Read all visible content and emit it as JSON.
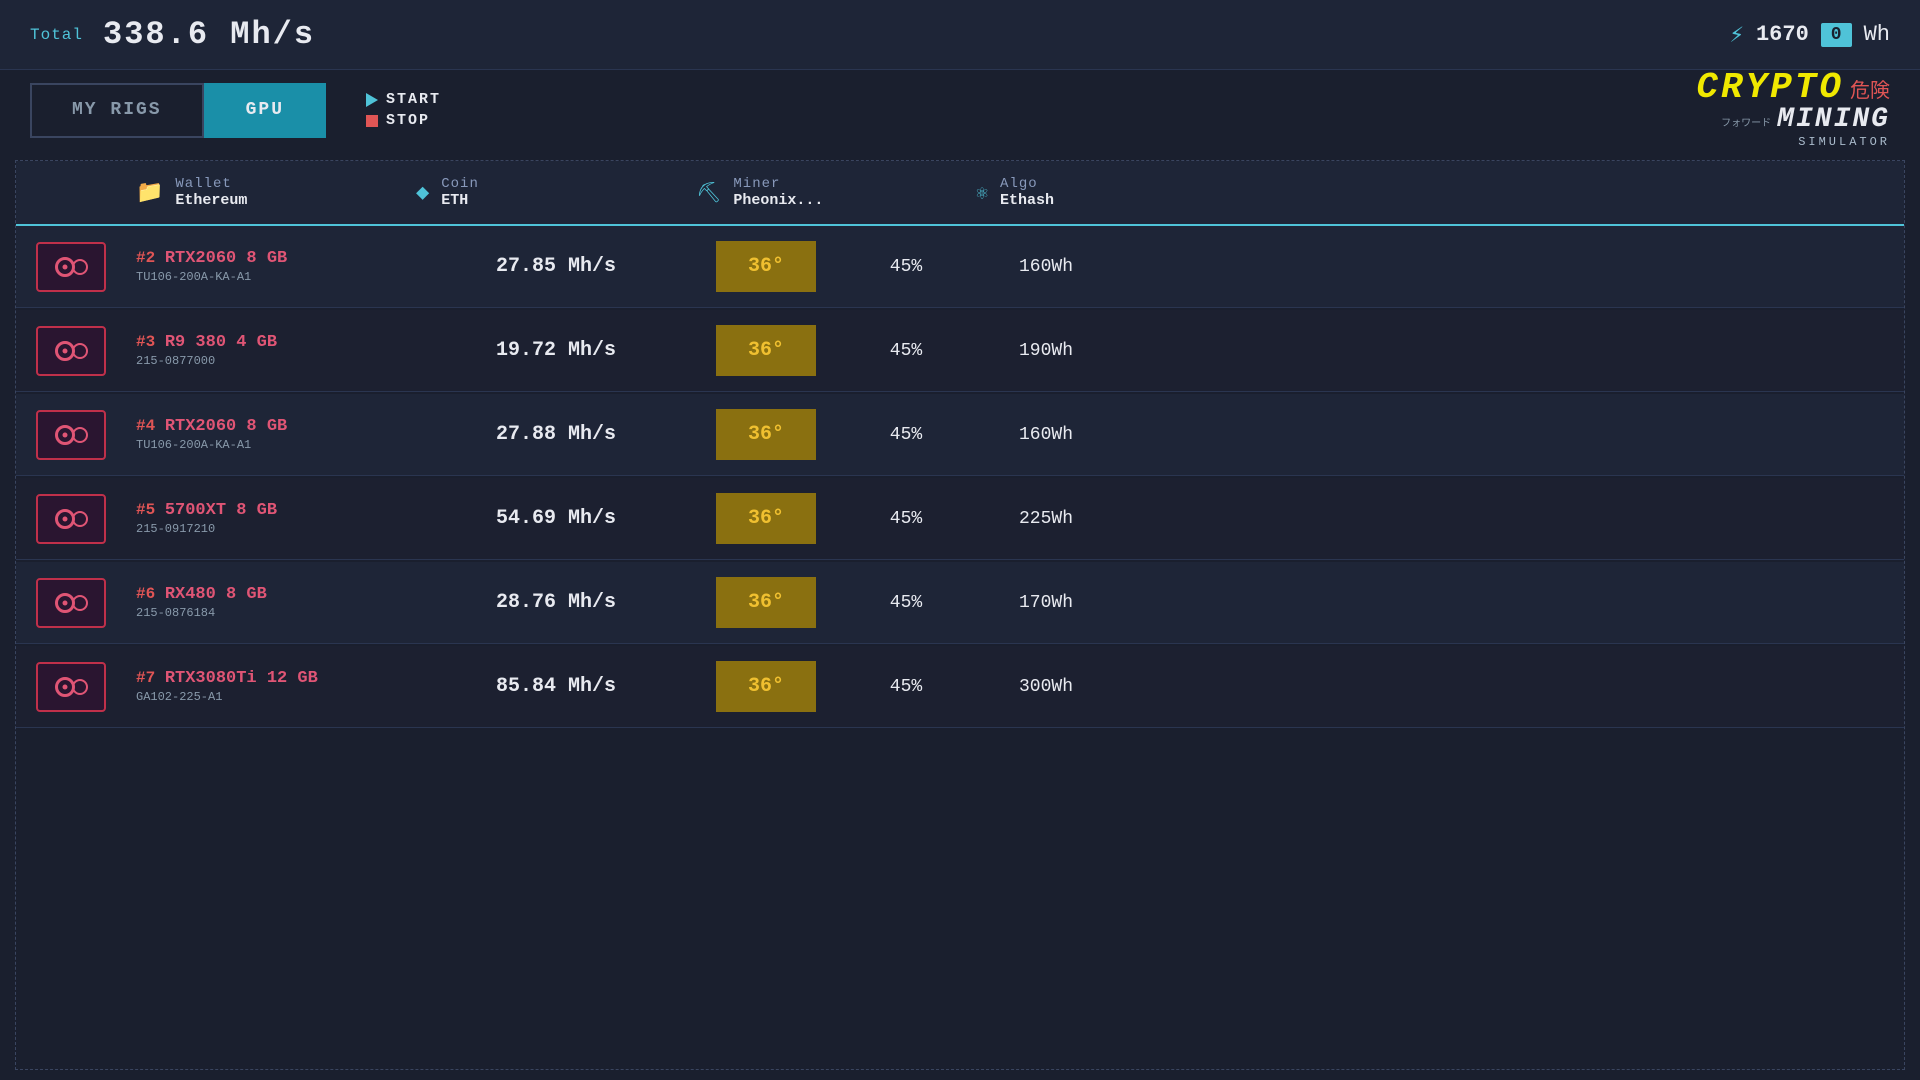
{
  "topbar": {
    "total_label": "Total",
    "hashrate": "338.6 Mh/s",
    "power_icon": "⚡",
    "power_value": "1670",
    "power_zero": "0",
    "power_unit": "Wh"
  },
  "nav": {
    "tab_rigs": "MY RIGS",
    "tab_gpu": "GPU",
    "btn_start": "START",
    "btn_stop": "STOP"
  },
  "logo": {
    "line1": "CRYPTO",
    "line1_jp": "危険",
    "line2": "MINING",
    "line3": "SIMULATOR",
    "line3_jp": "フォワード"
  },
  "table_header": {
    "wallet_label": "Wallet",
    "wallet_value": "Ethereum",
    "coin_label": "Coin",
    "coin_value": "ETH",
    "miner_label": "Miner",
    "miner_value": "Pheonix...",
    "algo_label": "Algo",
    "algo_value": "Ethash"
  },
  "gpus": [
    {
      "number": "#2",
      "name": "RTX2060 8 GB",
      "id": "TU106-200A-KA-A1",
      "hashrate": "27.85 Mh/s",
      "temp": "36°",
      "fan": "45%",
      "power": "160Wh"
    },
    {
      "number": "#3",
      "name": "R9 380 4 GB",
      "id": "215-0877000",
      "hashrate": "19.72 Mh/s",
      "temp": "36°",
      "fan": "45%",
      "power": "190Wh"
    },
    {
      "number": "#4",
      "name": "RTX2060 8 GB",
      "id": "TU106-200A-KA-A1",
      "hashrate": "27.88 Mh/s",
      "temp": "36°",
      "fan": "45%",
      "power": "160Wh"
    },
    {
      "number": "#5",
      "name": "5700XT 8 GB",
      "id": "215-0917210",
      "hashrate": "54.69 Mh/s",
      "temp": "36°",
      "fan": "45%",
      "power": "225Wh"
    },
    {
      "number": "#6",
      "name": "RX480 8 GB",
      "id": "215-0876184",
      "hashrate": "28.76 Mh/s",
      "temp": "36°",
      "fan": "45%",
      "power": "170Wh"
    },
    {
      "number": "#7",
      "name": "RTX3080Ti 12 GB",
      "id": "GA102-225-A1",
      "hashrate": "85.84 Mh/s",
      "temp": "36°",
      "fan": "45%",
      "power": "300Wh"
    }
  ]
}
